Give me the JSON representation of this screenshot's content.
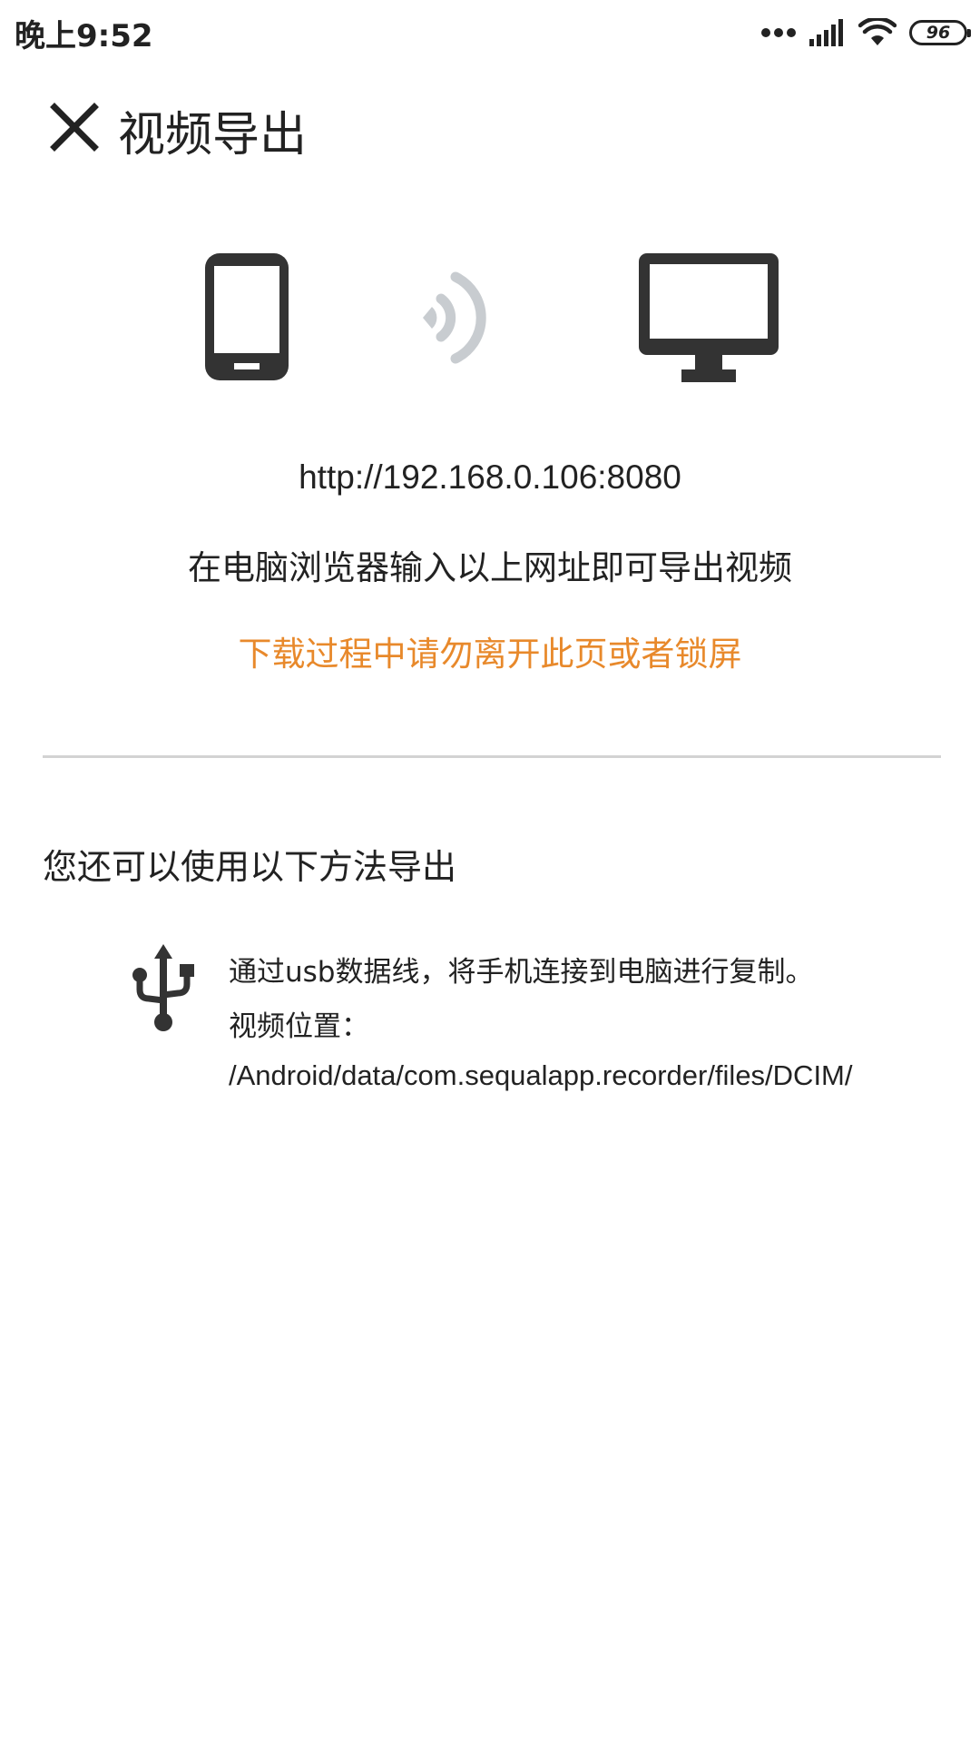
{
  "status_bar": {
    "time": "晚上9:52",
    "battery": "96"
  },
  "toolbar": {
    "title": "视频导出"
  },
  "illustration": {
    "phone": "phone-icon",
    "signal": "signal-waves-icon",
    "monitor": "monitor-icon"
  },
  "wifi_transfer": {
    "url": "http://192.168.0.106:8080",
    "hint": "在电脑浏览器输入以上网址即可导出视频",
    "warning": "下载过程中请勿离开此页或者锁屏"
  },
  "alternative": {
    "title": "您还可以使用以下方法导出",
    "usb": {
      "icon": "usb-icon",
      "description": "通过usb数据线，将手机连接到电脑进行复制。",
      "location_label": "视频位置：",
      "path": "/Android/data/com.sequalapp.recorder/files/DCIM/"
    }
  },
  "colors": {
    "warning": "#e8892b",
    "icon_dark": "#333333",
    "icon_light": "#c8ccd0",
    "divider": "#d3d3d3"
  }
}
